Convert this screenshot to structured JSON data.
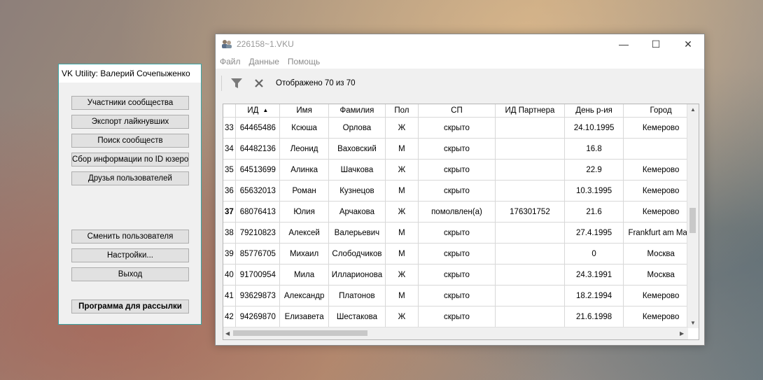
{
  "left_window": {
    "title": "VK Utility: Валерий Сочепыженко",
    "buttons": [
      "Участники сообщества",
      "Экспорт лайкнувших",
      "Поиск сообществ",
      "Сбор информации по ID юзеров",
      "Друзья пользователей",
      "Сменить пользователя",
      "Настройки...",
      "Выход",
      "Программа для рассылки"
    ]
  },
  "main_window": {
    "title": "226158~1.VKU",
    "menu": [
      "Файл",
      "Данные",
      "Помощь"
    ],
    "toolbar_status": "Отображено 70 из 70"
  },
  "table": {
    "columns": [
      "",
      "ИД",
      "Имя",
      "Фамилия",
      "Пол",
      "СП",
      "ИД Партнера",
      "День р-ия",
      "Город"
    ],
    "sort_column": "ИД",
    "rows": [
      [
        "33",
        "64465486",
        "Ксюша",
        "Орлова",
        "Ж",
        "скрыто",
        "",
        "24.10.1995",
        "Кемерово"
      ],
      [
        "34",
        "64482136",
        "Леонид",
        "Ваховский",
        "М",
        "скрыто",
        "",
        "16.8",
        ""
      ],
      [
        "35",
        "64513699",
        "Алинка",
        "Шачкова",
        "Ж",
        "скрыто",
        "",
        "22.9",
        "Кемерово"
      ],
      [
        "36",
        "65632013",
        "Роман",
        "Кузнецов",
        "М",
        "скрыто",
        "",
        "10.3.1995",
        "Кемерово"
      ],
      [
        "37",
        "68076413",
        "Юлия",
        "Арчакова",
        "Ж",
        "помолвлен(а)",
        "176301752",
        "21.6",
        "Кемерово"
      ],
      [
        "38",
        "79210823",
        "Алексей",
        "Валерьевич",
        "М",
        "скрыто",
        "",
        "27.4.1995",
        "Frankfurt am Main"
      ],
      [
        "39",
        "85776705",
        "Михаил",
        "Слободчиков",
        "М",
        "скрыто",
        "",
        "0",
        "Москва"
      ],
      [
        "40",
        "91700954",
        "Мила",
        "Илларионова",
        "Ж",
        "скрыто",
        "",
        "24.3.1991",
        "Москва"
      ],
      [
        "41",
        "93629873",
        "Александр",
        "Платонов",
        "М",
        "скрыто",
        "",
        "18.2.1994",
        "Кемерово"
      ],
      [
        "42",
        "94269870",
        "Елизавета",
        "Шестакова",
        "Ж",
        "скрыто",
        "",
        "21.6.1998",
        "Кемерово"
      ]
    ],
    "highlighted_row": "37"
  },
  "icons": [
    "filter-icon",
    "clear-icon",
    "app-icon",
    "minimize-icon",
    "maximize-icon",
    "close-icon"
  ]
}
